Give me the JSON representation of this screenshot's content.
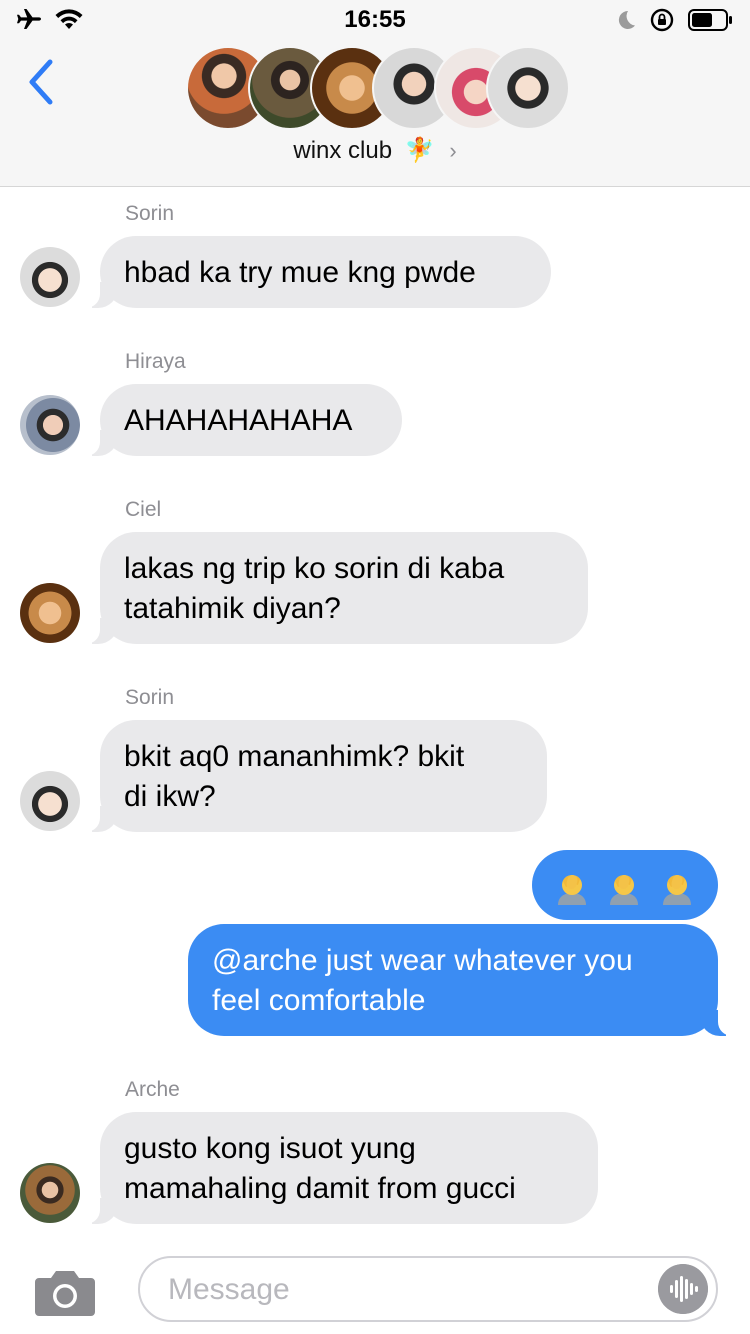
{
  "status_bar": {
    "time": "16:55"
  },
  "header": {
    "group_name": "winx club",
    "group_emoji": "🧚",
    "chevron": "›"
  },
  "messages": [
    {
      "sender": "Sorin",
      "text": "hbad ka try mue kng pwde"
    },
    {
      "sender": "Hiraya",
      "text": "AHAHAHAHAHA"
    },
    {
      "sender": "Ciel",
      "line1": "lakas ng trip ko sorin di kaba",
      "line2": "tatahimik diyan?"
    },
    {
      "sender": "Sorin",
      "line1": "bkit aq0 mananhimk? bkit",
      "line2": "di ikw?"
    },
    {
      "sender": "me",
      "emoji": "facepalm-emoji x3"
    },
    {
      "sender": "me",
      "line1": "@arche just wear whatever you",
      "line2": "feel comfortable"
    },
    {
      "sender": "Arche",
      "line1": "gusto kong isuot yung",
      "line2": "mamahaling damit from gucci"
    }
  ],
  "input": {
    "placeholder": "Message"
  },
  "colors": {
    "outgoing": "#3b8cf3",
    "incoming": "#e9e9eb",
    "back": "#2f7cf6"
  }
}
